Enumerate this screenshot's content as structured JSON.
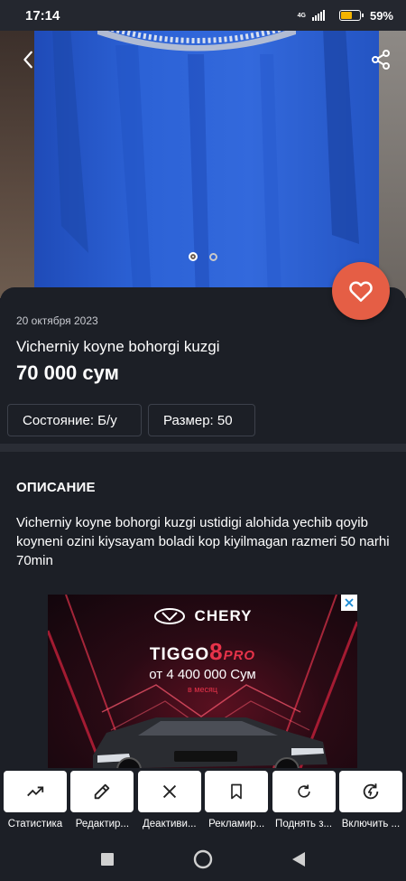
{
  "status_bar": {
    "time": "17:14",
    "network": "4G",
    "battery_percent": "59%",
    "battery_level": 0.59,
    "battery_color": "#f4b400"
  },
  "gallery": {
    "photo_count": 2,
    "active_photo": 1,
    "back_icon": "chevron-left-icon",
    "share_icon": "share-icon",
    "favorite_icon": "heart-icon",
    "favorite_color": "#e55e45"
  },
  "listing": {
    "date": "20 октября 2023",
    "title": "Vicherniy koyne bohorgi kuzgi",
    "price": "70 000 сум",
    "attributes": [
      {
        "label": "Состояние: Б/у"
      },
      {
        "label": "Размер: 50"
      }
    ]
  },
  "description": {
    "heading": "ОПИСАНИЕ",
    "text": "Vicherniy koyne bohorgi kuzgi ustidigi alohida yechib qoyib koyneni ozini kiysayam boladi kop kiyilmagan razmeri 50 narhi 70min"
  },
  "ad": {
    "brand": "CHERY",
    "model_prefix": "TIGGO",
    "model_number": "8",
    "model_suffix": "PRO",
    "price": "от 4 400 000 Сум",
    "months": "в месяц",
    "close_icon": "close-icon"
  },
  "actions": [
    {
      "label": "Статистика",
      "icon": "trend-up-icon"
    },
    {
      "label": "Редактир...",
      "icon": "pencil-icon"
    },
    {
      "label": "Деактиви...",
      "icon": "close-icon"
    },
    {
      "label": "Рекламир...",
      "icon": "bookmark-icon"
    },
    {
      "label": "Поднять з...",
      "icon": "refresh-icon"
    },
    {
      "label": "Включить ...",
      "icon": "auto-renew-icon"
    }
  ],
  "nav": {
    "recents_icon": "square-icon",
    "home_icon": "circle-icon",
    "back_icon": "triangle-back-icon"
  },
  "colors": {
    "background": "#1c1f26",
    "accent": "#e55e45",
    "dress": "#2b5fd0"
  }
}
